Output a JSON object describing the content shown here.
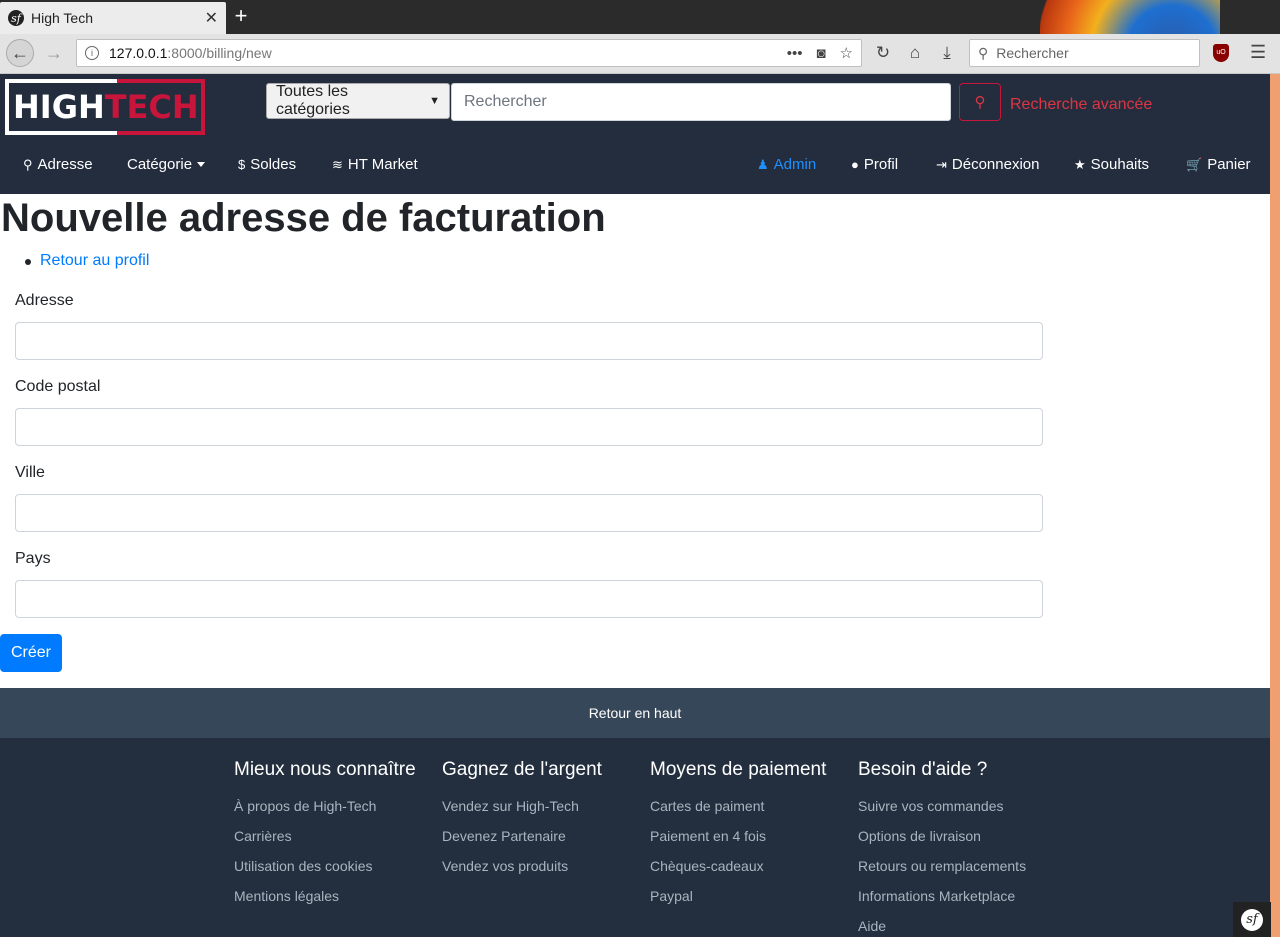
{
  "browser": {
    "tab_title": "High Tech",
    "tab_close": "✕",
    "new_tab": "+",
    "url_host": "127.0.0.1",
    "url_path": ":8000/billing/new",
    "search_placeholder": "Rechercher"
  },
  "header": {
    "logo_high": "HIGH",
    "logo_tech": "TECH",
    "category_select": "Toutes les catégories",
    "search_placeholder": "Rechercher",
    "advanced_search": "Recherche avancée"
  },
  "menu": {
    "left": [
      {
        "label": "Adresse",
        "icon": "map-marker-icon"
      },
      {
        "label": "Catégorie",
        "icon": "caret-icon"
      },
      {
        "label": "Soldes",
        "icon": "dollar-icon"
      },
      {
        "label": "HT Market",
        "icon": "coins-icon"
      }
    ],
    "right": [
      {
        "label": "Admin",
        "icon": "admin-icon",
        "active": true
      },
      {
        "label": "Profil",
        "icon": "user-icon"
      },
      {
        "label": "Déconnexion",
        "icon": "sign-out-icon"
      },
      {
        "label": "Souhaits",
        "icon": "star-icon"
      },
      {
        "label": "Panier",
        "icon": "cart-icon"
      }
    ]
  },
  "main": {
    "title": "Nouvelle adresse de facturation",
    "back_link": "Retour au profil",
    "fields": [
      {
        "label": "Adresse",
        "value": ""
      },
      {
        "label": "Code postal",
        "value": ""
      },
      {
        "label": "Ville",
        "value": ""
      },
      {
        "label": "Pays",
        "value": ""
      }
    ],
    "submit": "Créer"
  },
  "footer": {
    "back_to_top": "Retour en haut",
    "columns": [
      {
        "title": "Mieux nous connaître",
        "links": [
          "À propos de High-Tech",
          "Carrières",
          "Utilisation des cookies",
          "Mentions légales"
        ]
      },
      {
        "title": "Gagnez de l'argent",
        "links": [
          "Vendez sur High-Tech",
          "Devenez Partenaire",
          "Vendez vos produits"
        ]
      },
      {
        "title": "Moyens de paiement",
        "links": [
          "Cartes de paiment",
          "Paiement en 4 fois",
          "Chèques-cadeaux",
          "Paypal"
        ]
      },
      {
        "title": "Besoin d'aide ?",
        "links": [
          "Suivre vos commandes",
          "Options de livraison",
          "Retours ou remplacements",
          "Informations Marketplace",
          "Aide"
        ]
      }
    ]
  },
  "colors": {
    "brand_red": "#c8153b",
    "header_bg": "#232d3d",
    "primary": "#007bff",
    "footer_bg": "#232f3e"
  }
}
